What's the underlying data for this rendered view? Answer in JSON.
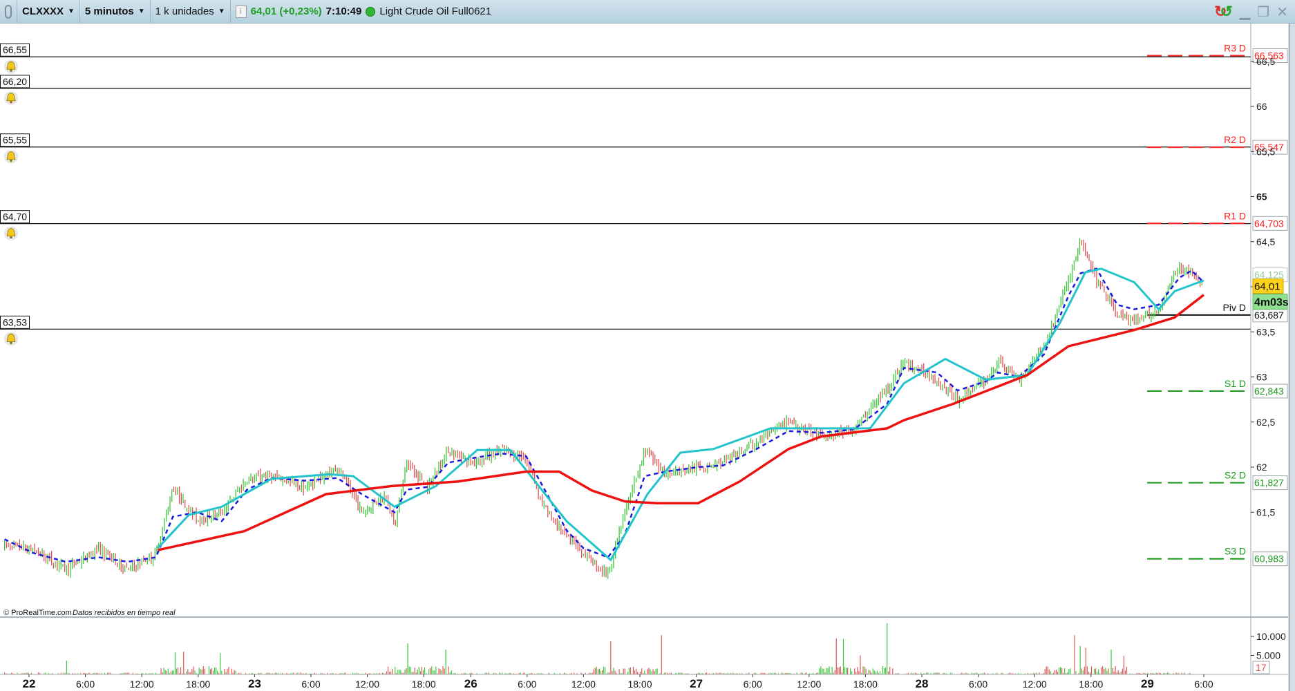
{
  "toolbar": {
    "symbol": "CLXXXX",
    "timeframe": "5 minutos",
    "units": "1 k unidades",
    "price_change": "64,01 (+0,23%)",
    "time": "7:10:49",
    "instrument_name": "Light Crude Oil Full0621",
    "icons": [
      "link-icon",
      "info-icon",
      "status-dot-icon",
      "refresh-icon",
      "minimize-icon",
      "restore-icon",
      "close-icon"
    ]
  },
  "footer": {
    "copyright": "© ProRealTime.com",
    "realtime_note": "Datos recibidos en tiempo real"
  },
  "colors": {
    "up": "#3cc83c",
    "down": "#e05555",
    "ma_red": "#ee1111",
    "kijun_cyan": "#22c4cc",
    "tenkan_blue": "#1a1ae0",
    "resistance": "#ff2020",
    "support": "#1a9a1a"
  },
  "chart_data": {
    "type": "candlestick",
    "title": "Light Crude Oil Full0621 - 5 minutos",
    "ylim": [
      60.4,
      66.9
    ],
    "y_ticks": [
      {
        "value": 66.5,
        "label": "66,5"
      },
      {
        "value": 66,
        "label": "66"
      },
      {
        "value": 65.5,
        "label": "65,5"
      },
      {
        "value": 65,
        "label": "65",
        "bold": true
      },
      {
        "value": 64.5,
        "label": "64,5"
      },
      {
        "value": 64,
        "label": "64"
      },
      {
        "value": 63.5,
        "label": "63,5"
      },
      {
        "value": 63,
        "label": "63"
      },
      {
        "value": 62.5,
        "label": "62,5"
      },
      {
        "value": 62,
        "label": "62"
      },
      {
        "value": 61.5,
        "label": "61,5"
      }
    ],
    "x_unit": "trading hours since 22 0:00",
    "x_ticks": [
      {
        "t": 0,
        "label": "22",
        "bold": true
      },
      {
        "t": 6,
        "label": "6:00"
      },
      {
        "t": 12,
        "label": "12:00"
      },
      {
        "t": 18,
        "label": "18:00"
      },
      {
        "t": 24,
        "label": "23",
        "bold": true
      },
      {
        "t": 30,
        "label": "6:00"
      },
      {
        "t": 36,
        "label": "12:00"
      },
      {
        "t": 42,
        "label": "18:00"
      },
      {
        "t": 47,
        "label": "26",
        "bold": true
      },
      {
        "t": 53,
        "label": "6:00"
      },
      {
        "t": 59,
        "label": "12:00"
      },
      {
        "t": 65,
        "label": "18:00"
      },
      {
        "t": 71,
        "label": "27",
        "bold": true
      },
      {
        "t": 77,
        "label": "6:00"
      },
      {
        "t": 83,
        "label": "12:00"
      },
      {
        "t": 89,
        "label": "18:00"
      },
      {
        "t": 95,
        "label": "28",
        "bold": true
      },
      {
        "t": 101,
        "label": "6:00"
      },
      {
        "t": 107,
        "label": "12:00"
      },
      {
        "t": 113,
        "label": "18:00"
      },
      {
        "t": 119,
        "label": "29",
        "bold": true
      },
      {
        "t": 125,
        "label": "6:00"
      }
    ],
    "price_path": [
      [
        -2.6,
        61.13
      ],
      [
        0.4,
        61.09
      ],
      [
        3.9,
        60.86
      ],
      [
        7.4,
        61.09
      ],
      [
        10.5,
        60.86
      ],
      [
        13.5,
        61.04
      ],
      [
        15.3,
        61.77
      ],
      [
        17.9,
        61.41
      ],
      [
        20.5,
        61.5
      ],
      [
        23.2,
        61.87
      ],
      [
        25.8,
        61.91
      ],
      [
        29.3,
        61.77
      ],
      [
        32.8,
        62.0
      ],
      [
        35.4,
        61.5
      ],
      [
        38,
        61.69
      ],
      [
        38.9,
        61.32
      ],
      [
        40.2,
        62.05
      ],
      [
        42.4,
        61.77
      ],
      [
        44.6,
        62.19
      ],
      [
        47.2,
        62.05
      ],
      [
        50.3,
        62.19
      ],
      [
        52.9,
        62.1
      ],
      [
        54.6,
        61.59
      ],
      [
        57.2,
        61.22
      ],
      [
        59,
        61.04
      ],
      [
        61.6,
        60.8
      ],
      [
        63.4,
        61.5
      ],
      [
        65.5,
        62.19
      ],
      [
        67.7,
        61.93
      ],
      [
        71.2,
        62.0
      ],
      [
        73.9,
        62.05
      ],
      [
        77.4,
        62.28
      ],
      [
        80.8,
        62.51
      ],
      [
        84.3,
        62.33
      ],
      [
        87.8,
        62.42
      ],
      [
        91.3,
        62.88
      ],
      [
        93.1,
        63.16
      ],
      [
        96.6,
        62.97
      ],
      [
        98.8,
        62.75
      ],
      [
        101.8,
        62.97
      ],
      [
        103.1,
        63.16
      ],
      [
        105.3,
        62.97
      ],
      [
        108,
        63.34
      ],
      [
        110.6,
        64.07
      ],
      [
        111.9,
        64.5
      ],
      [
        113.6,
        64.07
      ],
      [
        115.8,
        63.7
      ],
      [
        117.6,
        63.6
      ],
      [
        120.2,
        63.75
      ],
      [
        122.4,
        64.25
      ],
      [
        123.7,
        64.12
      ],
      [
        125,
        64.01
      ]
    ],
    "series": [
      {
        "name": "Moving average (red)",
        "points": [
          [
            13.7,
            61.08
          ],
          [
            22.9,
            61.29
          ],
          [
            31.6,
            61.7
          ],
          [
            38.6,
            61.79
          ],
          [
            45.6,
            61.84
          ],
          [
            52.9,
            61.95
          ],
          [
            56.4,
            61.95
          ],
          [
            59.9,
            61.74
          ],
          [
            63.4,
            61.62
          ],
          [
            66.9,
            61.6
          ],
          [
            71.2,
            61.6
          ],
          [
            75.6,
            61.84
          ],
          [
            80.8,
            62.2
          ],
          [
            84.3,
            62.34
          ],
          [
            91.3,
            62.43
          ],
          [
            93.1,
            62.52
          ],
          [
            98.3,
            62.7
          ],
          [
            106.2,
            63.02
          ],
          [
            110.6,
            63.34
          ],
          [
            117.6,
            63.52
          ],
          [
            121.9,
            63.66
          ],
          [
            125,
            63.91
          ]
        ]
      },
      {
        "name": "Kijun (cyan)",
        "points": [
          [
            13.7,
            61.1
          ],
          [
            17,
            61.47
          ],
          [
            20.5,
            61.56
          ],
          [
            25.8,
            61.87
          ],
          [
            31.9,
            61.92
          ],
          [
            34.5,
            61.9
          ],
          [
            38.9,
            61.56
          ],
          [
            43.3,
            61.79
          ],
          [
            47.7,
            62.19
          ],
          [
            51.2,
            62.19
          ],
          [
            57.2,
            61.4
          ],
          [
            61.9,
            60.97
          ],
          [
            65.8,
            61.7
          ],
          [
            69.3,
            62.16
          ],
          [
            72.8,
            62.2
          ],
          [
            78.9,
            62.43
          ],
          [
            84.3,
            62.43
          ],
          [
            89.5,
            62.43
          ],
          [
            93.1,
            62.93
          ],
          [
            97.5,
            63.2
          ],
          [
            101.8,
            62.97
          ],
          [
            106.2,
            63.02
          ],
          [
            109.7,
            63.6
          ],
          [
            112.4,
            64.16
          ],
          [
            114.1,
            64.2
          ],
          [
            117.6,
            64.05
          ],
          [
            120.2,
            63.75
          ],
          [
            121.9,
            63.95
          ],
          [
            125,
            64.07
          ]
        ]
      },
      {
        "name": "Tenkan (blue dashed)",
        "points": [
          [
            -2.6,
            61.2
          ],
          [
            0.4,
            61.05
          ],
          [
            3.9,
            60.95
          ],
          [
            7.4,
            61.0
          ],
          [
            10.5,
            60.95
          ],
          [
            13.5,
            61.0
          ],
          [
            15.3,
            61.45
          ],
          [
            17.9,
            61.5
          ],
          [
            20.5,
            61.4
          ],
          [
            23.2,
            61.75
          ],
          [
            25.8,
            61.88
          ],
          [
            29.3,
            61.85
          ],
          [
            32.8,
            61.88
          ],
          [
            35.4,
            61.7
          ],
          [
            38.9,
            61.5
          ],
          [
            40.2,
            61.75
          ],
          [
            42.4,
            61.78
          ],
          [
            44.6,
            62.05
          ],
          [
            47.2,
            62.1
          ],
          [
            50.3,
            62.15
          ],
          [
            52.9,
            62.12
          ],
          [
            54.6,
            61.8
          ],
          [
            57.2,
            61.3
          ],
          [
            59,
            61.1
          ],
          [
            61.6,
            61.0
          ],
          [
            63.4,
            61.25
          ],
          [
            65.5,
            61.9
          ],
          [
            67.7,
            61.95
          ],
          [
            71.2,
            62.0
          ],
          [
            73.9,
            62.02
          ],
          [
            77.4,
            62.2
          ],
          [
            80.8,
            62.4
          ],
          [
            84.3,
            62.38
          ],
          [
            87.8,
            62.42
          ],
          [
            91.3,
            62.7
          ],
          [
            93.1,
            63.1
          ],
          [
            96.6,
            63.05
          ],
          [
            98.8,
            62.85
          ],
          [
            101.8,
            62.95
          ],
          [
            103.1,
            63.05
          ],
          [
            105.3,
            63.0
          ],
          [
            108,
            63.25
          ],
          [
            110.6,
            63.9
          ],
          [
            111.9,
            64.15
          ],
          [
            113.6,
            64.2
          ],
          [
            115.8,
            63.8
          ],
          [
            117.6,
            63.75
          ],
          [
            120.2,
            63.8
          ],
          [
            122.4,
            64.1
          ],
          [
            123.7,
            64.18
          ],
          [
            125,
            64.05
          ]
        ]
      }
    ],
    "pivots": [
      {
        "label": "R3 D",
        "value": 66.563,
        "value_label": "66,563",
        "kind": "resistance"
      },
      {
        "label": "R2 D",
        "value": 65.547,
        "value_label": "65,547",
        "kind": "resistance"
      },
      {
        "label": "R1 D",
        "value": 64.703,
        "value_label": "64,703",
        "kind": "resistance"
      },
      {
        "label": "Piv D",
        "value": 63.687,
        "value_label": "63,687",
        "kind": "pivot"
      },
      {
        "label": "S1 D",
        "value": 62.843,
        "value_label": "62,843",
        "kind": "support"
      },
      {
        "label": "S2 D",
        "value": 61.827,
        "value_label": "61,827",
        "kind": "support"
      },
      {
        "label": "S3 D",
        "value": 60.983,
        "value_label": "60,983",
        "kind": "support"
      }
    ],
    "alerts": [
      {
        "value": 66.55,
        "label": "66,55"
      },
      {
        "value": 66.2,
        "label": "66,20"
      },
      {
        "value": 65.55,
        "label": "65,55"
      },
      {
        "value": 64.7,
        "label": "64,70"
      },
      {
        "value": 63.53,
        "label": "63,53"
      }
    ],
    "current_price": {
      "value": 64.01,
      "label": "64,01",
      "countdown": "4m03s"
    },
    "cloud_level": {
      "value": 64.125,
      "label": "64,125"
    },
    "volume": {
      "y_ticks": [
        {
          "value": 10000,
          "label": "10.000"
        },
        {
          "value": 5000,
          "label": "5.000"
        }
      ],
      "current_label": "17",
      "spikes": [
        [
          4,
          3600
        ],
        [
          15.5,
          5800
        ],
        [
          16.5,
          6000
        ],
        [
          20.3,
          5600
        ],
        [
          40.3,
          8200
        ],
        [
          44.4,
          6500
        ],
        [
          61.9,
          8700
        ],
        [
          67.3,
          10300
        ],
        [
          85.9,
          9500
        ],
        [
          86.6,
          9300
        ],
        [
          88.4,
          5000
        ],
        [
          91.3,
          13500
        ],
        [
          111.3,
          10300
        ],
        [
          111.8,
          7500
        ],
        [
          112.5,
          7000
        ],
        [
          115.2,
          6500
        ],
        [
          116.5,
          4900
        ]
      ],
      "active_ranges": [
        [
          14,
          22
        ],
        [
          38,
          45
        ],
        [
          60,
          67
        ],
        [
          84,
          92
        ],
        [
          108,
          117
        ]
      ]
    }
  }
}
